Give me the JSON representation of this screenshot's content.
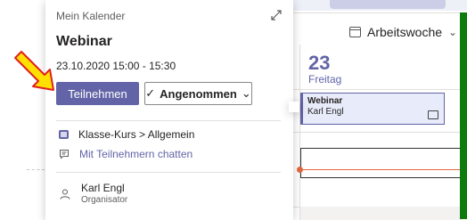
{
  "calendar_view": {
    "view_selector": "Arbeitswoche",
    "day_number": "23",
    "day_name": "Freitag",
    "event": {
      "title": "Webinar",
      "organizer": "Karl Engl"
    }
  },
  "popup": {
    "calendar_name": "Mein Kalender",
    "title": "Webinar",
    "datetime": "23.10.2020 15:00 - 15:30",
    "join_label": "Teilnehmen",
    "accepted_label": "Angenommen",
    "channel": "Klasse-Kurs > Allgemein",
    "chat_link": "Mit Teilnehmern chatten",
    "organizer_name": "Karl Engl",
    "organizer_role": "Organisator"
  },
  "colors": {
    "accent": "#6264a7",
    "arrow_fill": "#ffe000",
    "arrow_outline": "#e02020",
    "now_line": "#e06a3d"
  },
  "icons": [
    "expand-icon",
    "calendar-icon",
    "chevron-down-icon",
    "checkmark-icon",
    "channel-icon",
    "chat-icon",
    "person-icon",
    "meeting-icon",
    "pointer-arrow"
  ]
}
